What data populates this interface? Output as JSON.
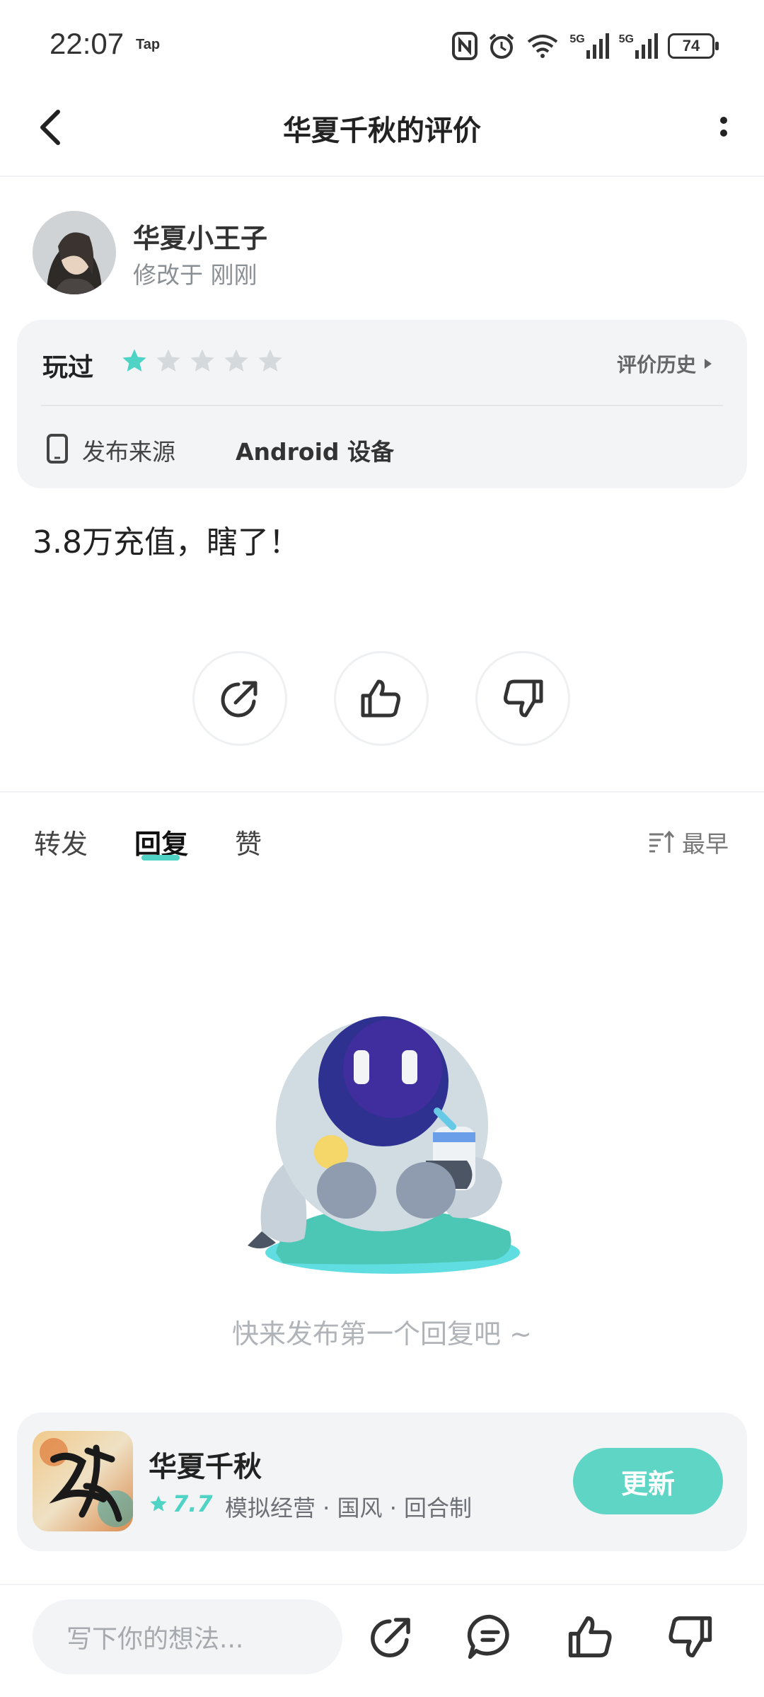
{
  "status_bar": {
    "time": "22:07",
    "app_badge": "Tap",
    "battery": "74",
    "signal_label_1": "5G",
    "signal_label_2": "5G"
  },
  "header": {
    "title": "华夏千秋的评价"
  },
  "review": {
    "author": "华夏小王子",
    "edited": "修改于 刚刚",
    "played_label": "玩过",
    "rating": 1,
    "max_rating": 5,
    "history_label": "评价历史",
    "source_label": "发布来源",
    "source_value": "Android 设备",
    "content": "3.8万充值，瞎了！"
  },
  "tabs": [
    {
      "label": "转发",
      "active": false
    },
    {
      "label": "回复",
      "active": true
    },
    {
      "label": "赞",
      "active": false
    }
  ],
  "sort_label": "最早",
  "empty_state": {
    "message": "快来发布第一个回复吧 ~"
  },
  "game": {
    "name": "华夏千秋",
    "score": "7.7",
    "tags": "模拟经营 · 国风 · 回合制",
    "action_label": "更新"
  },
  "bottom_bar": {
    "input_placeholder": "写下你的想法..."
  },
  "colors": {
    "accent": "#4ed3c4",
    "card_bg": "#f3f4f6"
  }
}
